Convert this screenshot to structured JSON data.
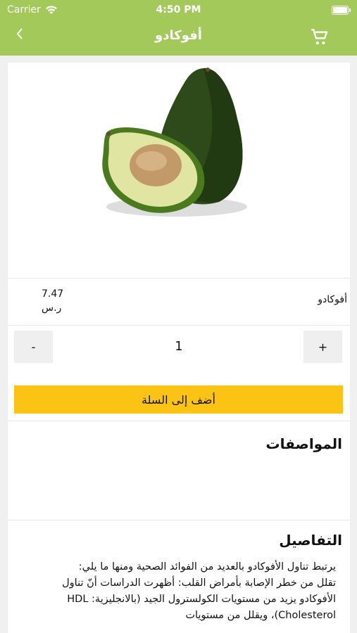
{
  "status_bar": {
    "carrier": "Carrier",
    "time": "4:50 PM"
  },
  "nav": {
    "title": "أفوكادو",
    "back_icon": "chevron-left-icon",
    "cart_icon": "cart-icon"
  },
  "product": {
    "name": "أفوكادو",
    "price": "7.47",
    "currency": "ر.س"
  },
  "quantity": {
    "minus": "-",
    "value": "1",
    "plus": "+"
  },
  "add_to_cart": "أضف إلى السلة",
  "specs": {
    "title": "المواصفات"
  },
  "details": {
    "title": "التفاصيل",
    "text": "يرتبط تناول الأفوكادو بالعديد من الفوائد الصحية ومنها ما يلي:\nتقلل من خطر الإصابة بأمراض القلب: أظهرت الدراسات أنّ تناول الأفوكادو يزيد من مستويات الكولسترول الجيد (بالانجليزية: HDL Cholesterol)، ويقلل من مستويات"
  },
  "colors": {
    "nav_bar": "#a2c95a",
    "add_button": "#fbc313",
    "background": "#f0f0f0"
  }
}
